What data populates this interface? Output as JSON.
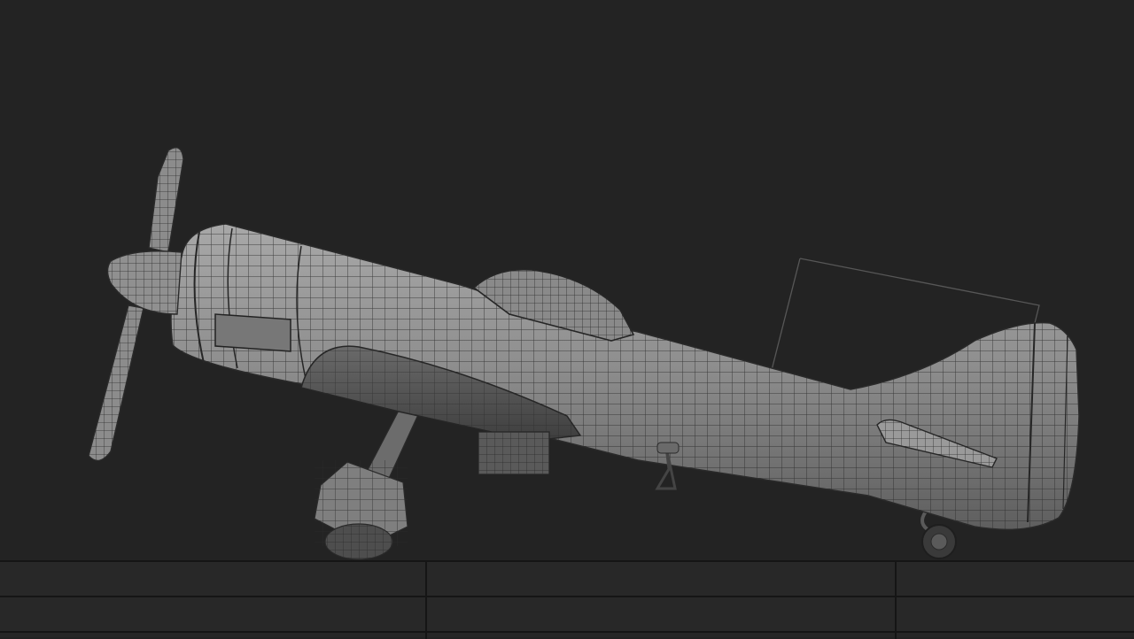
{
  "viewport": {
    "background": "#232323",
    "model": "propeller-aircraft-wireframe",
    "mesh_color": "#8c8c8c",
    "wire_color": "#2a2a2a",
    "selection_color": "#555555"
  },
  "timeline": {
    "rows": [
      {
        "cells": [
          "",
          "",
          ""
        ]
      },
      {
        "cells": [
          "",
          "",
          ""
        ]
      }
    ],
    "divider_color": "#151515"
  }
}
